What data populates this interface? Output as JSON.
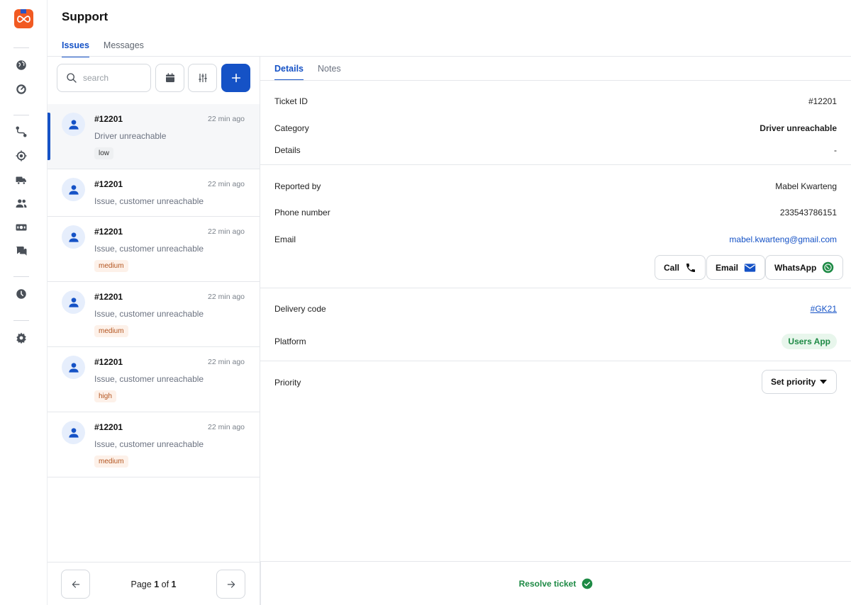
{
  "app": {
    "title": "Support"
  },
  "rail": {
    "icons": [
      "globe-icon",
      "speedometer-icon",
      "route-icon",
      "location-target-icon",
      "truck-icon",
      "users-icon",
      "cash-icon",
      "chat-icon",
      "clock-icon",
      "settings-gear-icon"
    ]
  },
  "tabs": [
    {
      "label": "Issues",
      "active": true
    },
    {
      "label": "Messages",
      "active": false
    }
  ],
  "search": {
    "placeholder": "search"
  },
  "tickets": [
    {
      "id": "#12201",
      "time": "22 min ago",
      "desc": "Driver unreachable",
      "priority": "low",
      "selected": true
    },
    {
      "id": "#12201",
      "time": "22 min ago",
      "desc": "Issue, customer unreachable",
      "priority": "",
      "selected": false
    },
    {
      "id": "#12201",
      "time": "22 min ago",
      "desc": "Issue, customer unreachable",
      "priority": "medium",
      "selected": false
    },
    {
      "id": "#12201",
      "time": "22 min ago",
      "desc": "Issue, customer unreachable",
      "priority": "medium",
      "selected": false
    },
    {
      "id": "#12201",
      "time": "22 min ago",
      "desc": "Issue, customer unreachable",
      "priority": "high",
      "selected": false
    },
    {
      "id": "#12201",
      "time": "22 min ago",
      "desc": "Issue, customer unreachable",
      "priority": "medium",
      "selected": false
    }
  ],
  "pager": {
    "prefix": "Page",
    "current": "1",
    "of": "of",
    "total": "1"
  },
  "detail_tabs": [
    {
      "label": "Details",
      "active": true
    },
    {
      "label": "Notes",
      "active": false
    }
  ],
  "details": {
    "ticket_id_label": "Ticket ID",
    "ticket_id": "#12201",
    "category_label": "Category",
    "category": "Driver unreachable",
    "details_label": "Details",
    "details": "-",
    "reported_by_label": "Reported by",
    "reported_by": "Mabel Kwarteng",
    "phone_label": "Phone number",
    "phone": "233543786151",
    "email_label": "Email",
    "email": "mabel.kwarteng@gmail.com",
    "delivery_code_label": "Delivery code",
    "delivery_code": "#GK21",
    "platform_label": "Platform",
    "platform": "Users App",
    "priority_label": "Priority",
    "priority_select": "Set priority"
  },
  "contact": {
    "call": "Call",
    "email": "Email",
    "whatsapp": "WhatsApp"
  },
  "resolve": {
    "label": "Resolve ticket"
  },
  "colors": {
    "accent": "#1552c6",
    "brand": "#f15a22",
    "success": "#1e8a45",
    "badge_warn_text": "#b3541e"
  }
}
